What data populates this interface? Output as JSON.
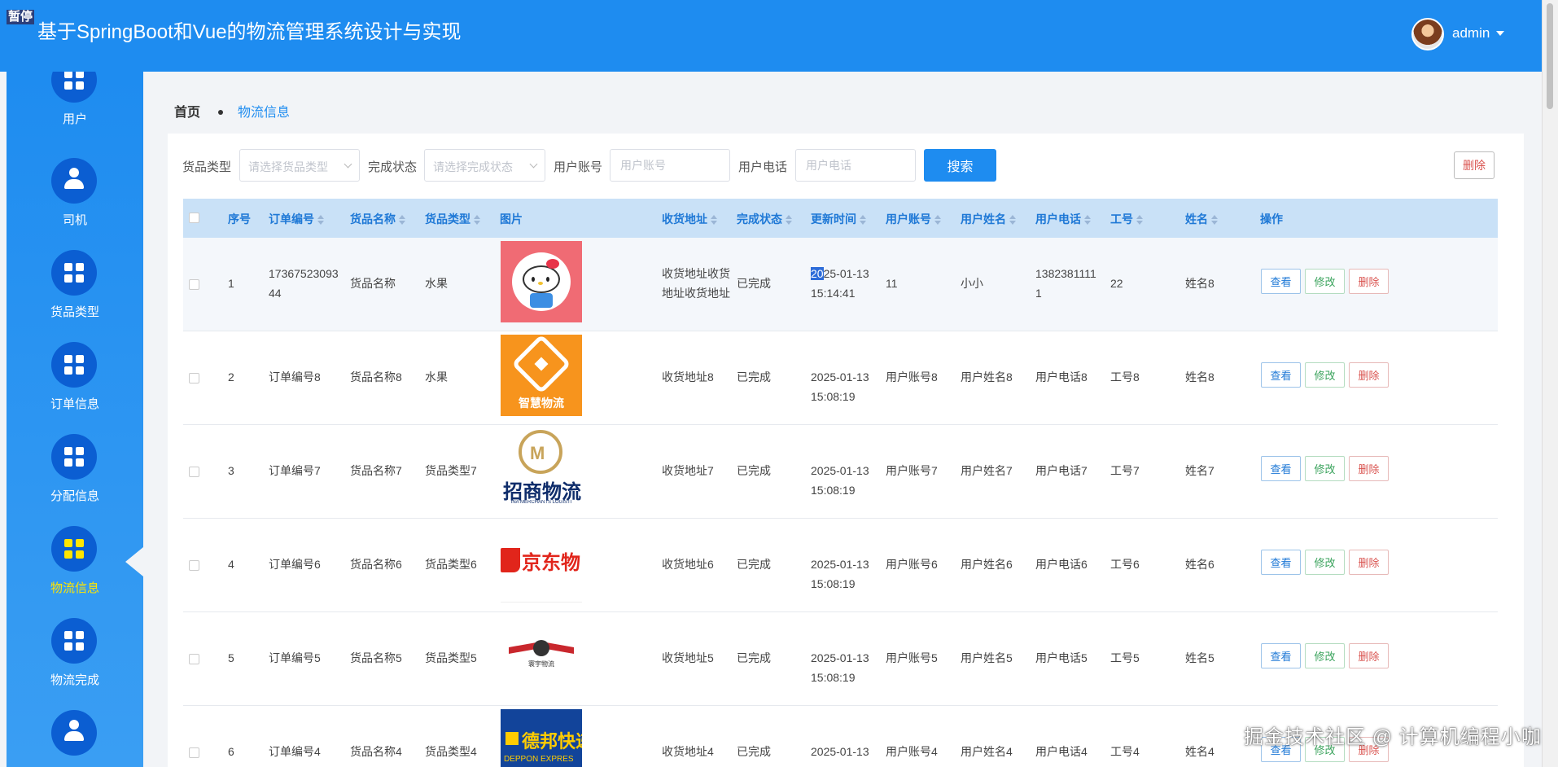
{
  "header": {
    "pause_badge": "暂停",
    "title": "基于SpringBoot和Vue的物流管理系统设计与实现",
    "user": "admin"
  },
  "sidebar": {
    "items": [
      {
        "label": "用户",
        "icon": "grid-icon"
      },
      {
        "label": "司机",
        "icon": "person-icon"
      },
      {
        "label": "货品类型",
        "icon": "grid-icon"
      },
      {
        "label": "订单信息",
        "icon": "grid-icon"
      },
      {
        "label": "分配信息",
        "icon": "grid-icon"
      },
      {
        "label": "物流信息",
        "icon": "grid-icon",
        "active": true
      },
      {
        "label": "物流完成",
        "icon": "grid-icon"
      },
      {
        "label": "",
        "icon": "stamp-icon"
      }
    ]
  },
  "breadcrumb": {
    "home": "首页",
    "current": "物流信息"
  },
  "filters": {
    "goods_type_label": "货品类型",
    "goods_type_placeholder": "请选择货品类型",
    "status_label": "完成状态",
    "status_placeholder": "请选择完成状态",
    "account_label": "用户账号",
    "account_placeholder": "用户账号",
    "phone_label": "用户电话",
    "phone_placeholder": "用户电话",
    "search_label": "搜索",
    "delete_label": "删除"
  },
  "table": {
    "headers": {
      "index": "序号",
      "order_no": "订单编号",
      "goods_name": "货品名称",
      "goods_type": "货品类型",
      "image": "图片",
      "address": "收货地址",
      "status": "完成状态",
      "updated": "更新时间",
      "account": "用户账号",
      "user_name": "用户姓名",
      "phone": "用户电话",
      "job_no": "工号",
      "name": "姓名",
      "actions": "操作"
    },
    "actions": {
      "view": "查看",
      "edit": "修改",
      "delete": "删除"
    },
    "rows": [
      {
        "index": "1",
        "order_no": "17367523093\n44",
        "goods_name": "货品名称",
        "goods_type": "水果",
        "image": "hello-kitty",
        "address": "收货地址收货\n地址收货地址",
        "status": "已完成",
        "updated_sel": "20",
        "updated_rest": "25-01-13\n15:14:41",
        "account": "11",
        "user_name": "小小",
        "phone": "1382381111\n1",
        "job_no": "22",
        "name": "姓名8"
      },
      {
        "index": "2",
        "order_no": "订单编号8",
        "goods_name": "货品名称8",
        "goods_type": "水果",
        "image": "logistics-logo",
        "image_text": "智慧物流",
        "address": "收货地址8",
        "status": "已完成",
        "updated": "2025-01-13\n15:08:19",
        "account": "用户账号8",
        "user_name": "用户姓名8",
        "phone": "用户电话8",
        "job_no": "工号8",
        "name": "姓名8"
      },
      {
        "index": "3",
        "order_no": "订单编号7",
        "goods_name": "货品名称7",
        "goods_type": "货品类型7",
        "image": "china-merchants-logo",
        "image_text": "招商物流",
        "image_subtext": "INA MERCHANTS LOGISTI",
        "address": "收货地址7",
        "status": "已完成",
        "updated": "2025-01-13\n15:08:19",
        "account": "用户账号7",
        "user_name": "用户姓名7",
        "phone": "用户电话7",
        "job_no": "工号7",
        "name": "姓名7"
      },
      {
        "index": "4",
        "order_no": "订单编号6",
        "goods_name": "货品名称6",
        "goods_type": "货品类型6",
        "image": "jd-logo",
        "image_text": "京东物",
        "address": "收货地址6",
        "status": "已完成",
        "updated": "2025-01-13\n15:08:19",
        "account": "用户账号6",
        "user_name": "用户姓名6",
        "phone": "用户电话6",
        "job_no": "工号6",
        "name": "姓名6"
      },
      {
        "index": "5",
        "order_no": "订单编号5",
        "goods_name": "货品名称5",
        "goods_type": "货品类型5",
        "image": "wings-globe-logo",
        "image_text": "寰宇物流",
        "address": "收货地址5",
        "status": "已完成",
        "updated": "2025-01-13\n15:08:19",
        "account": "用户账号5",
        "user_name": "用户姓名5",
        "phone": "用户电话5",
        "job_no": "工号5",
        "name": "姓名5"
      },
      {
        "index": "6",
        "order_no": "订单编号4",
        "goods_name": "货品名称4",
        "goods_type": "货品类型4",
        "image": "deppon-logo",
        "image_text": "德邦快递",
        "image_subtext": "DEPPON EXPRES",
        "address": "收货地址4",
        "status": "已完成",
        "updated": "2025-01-13\n15:08:19",
        "account": "用户账号4",
        "user_name": "用户姓名4",
        "phone": "用户电话4",
        "job_no": "工号4",
        "name": "姓名4"
      }
    ]
  },
  "watermark": "掘金技术社区 @ 计算机编程小咖"
}
